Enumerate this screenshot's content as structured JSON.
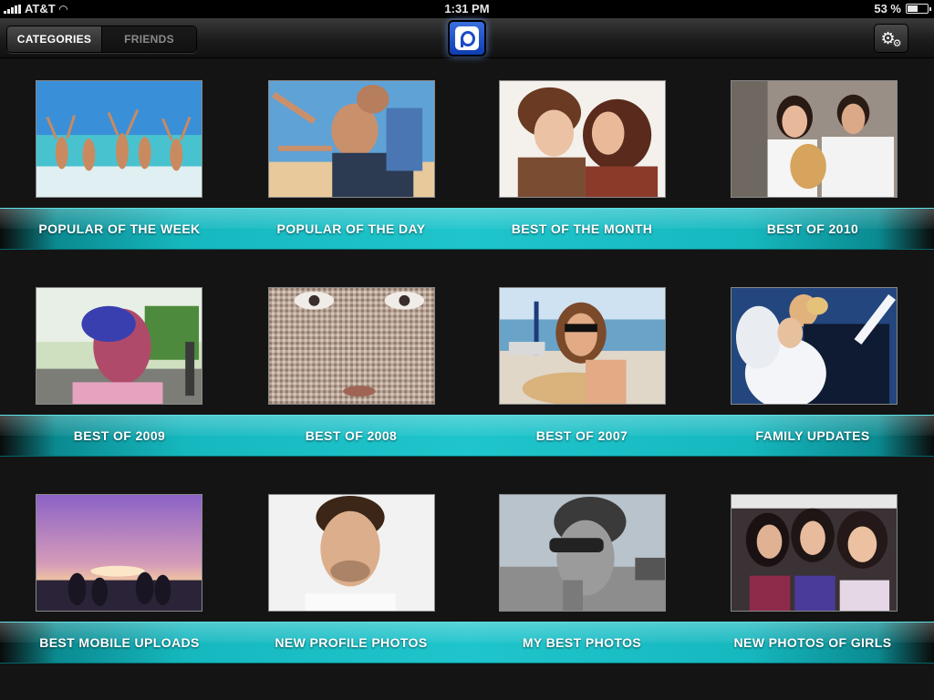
{
  "status": {
    "carrier": "AT&T",
    "time": "1:31 PM",
    "battery": "53 %",
    "battery_level": 0.53
  },
  "toolbar": {
    "tab_categories": "CATEGORIES",
    "tab_friends": "FRIENDS",
    "active_tab": "CATEGORIES"
  },
  "categories": [
    {
      "label": "POPULAR OF THE WEEK",
      "icon": "beach-group-photo"
    },
    {
      "label": "POPULAR OF THE DAY",
      "icon": "skydiving-photo"
    },
    {
      "label": "BEST OF THE MONTH",
      "icon": "two-women-photo"
    },
    {
      "label": "BEST OF 2010",
      "icon": "couple-with-dog-photo"
    },
    {
      "label": "BEST OF 2009",
      "icon": "painted-face-photo"
    },
    {
      "label": "BEST OF 2008",
      "icon": "mosaic-face-photo"
    },
    {
      "label": "BEST OF 2007",
      "icon": "beach-woman-photo"
    },
    {
      "label": "FAMILY UPDATES",
      "icon": "wedding-kiss-photo"
    },
    {
      "label": "BEST MOBILE UPLOADS",
      "icon": "sunset-silhouettes-photo"
    },
    {
      "label": "NEW PROFILE PHOTOS",
      "icon": "man-portrait-photo"
    },
    {
      "label": "MY BEST PHOTOS",
      "icon": "man-sunglasses-photo"
    },
    {
      "label": "NEW PHOTOS OF GIRLS",
      "icon": "three-girls-photo"
    }
  ],
  "colors": {
    "band": "#1fc5cc",
    "background": "#141414",
    "logo": "#1b4cc4"
  }
}
